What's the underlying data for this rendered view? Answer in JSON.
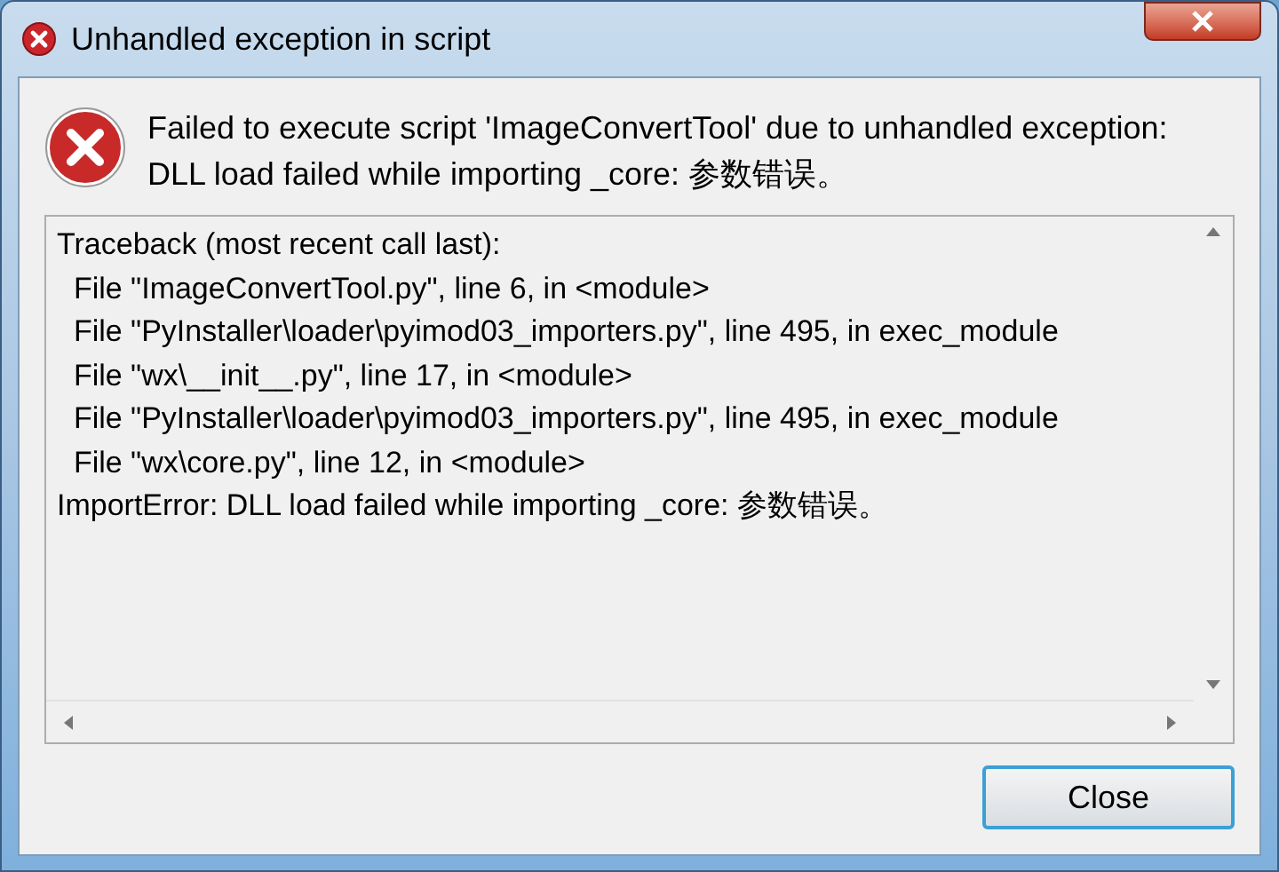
{
  "window": {
    "title": "Unhandled exception in script"
  },
  "message": [
    "Failed to execute script 'ImageConvertTool' due to unhandled exception:",
    "DLL load failed while importing _core: 参数错误。"
  ],
  "traceback": [
    "Traceback (most recent call last):",
    "  File \"ImageConvertTool.py\", line 6, in <module>",
    "  File \"PyInstaller\\loader\\pyimod03_importers.py\", line 495, in exec_module",
    "  File \"wx\\__init__.py\", line 17, in <module>",
    "  File \"PyInstaller\\loader\\pyimod03_importers.py\", line 495, in exec_module",
    "  File \"wx\\core.py\", line 12, in <module>",
    "ImportError: DLL load failed while importing _core: 参数错误。"
  ],
  "buttons": [
    {
      "label": "Close",
      "focused": true
    }
  ]
}
